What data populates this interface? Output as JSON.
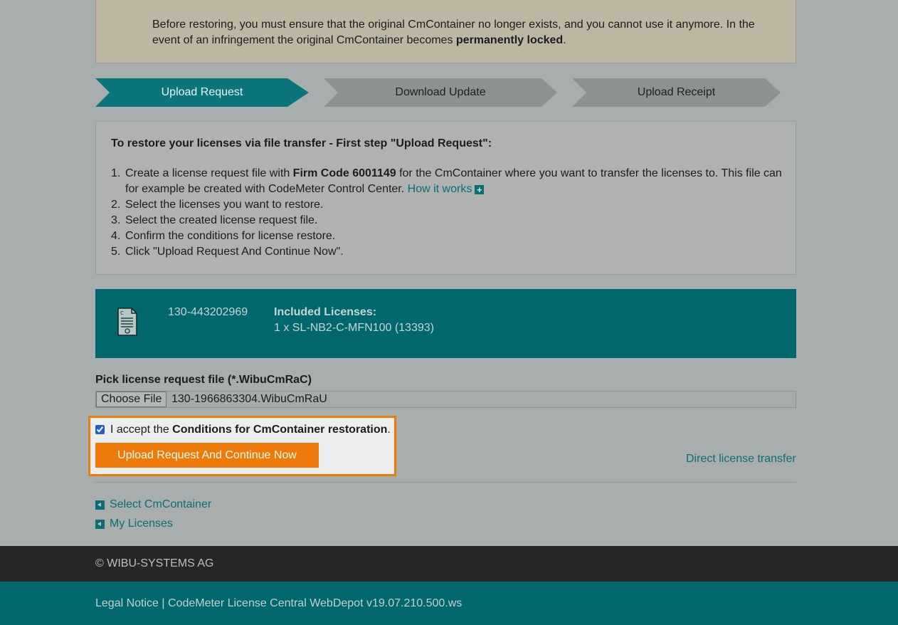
{
  "warning": {
    "text_before": "Before restoring, you must ensure that the original CmContainer no longer exists, and you cannot use it anymore. In the event of an infringement the original CmContainer becomes ",
    "text_bold": "permanently locked",
    "text_after": "."
  },
  "steps": [
    {
      "label": "Upload Request",
      "active": true
    },
    {
      "label": "Download Update",
      "active": false
    },
    {
      "label": "Upload Receipt",
      "active": false
    }
  ],
  "instructions": {
    "title": "To restore your licenses via file transfer - First step \"Upload Request\":",
    "items": [
      {
        "num": "1.",
        "text_before": "Create a license request file with ",
        "bold": "Firm Code 6001149",
        "text_after": " for the CmContainer where you want to transfer the licenses to. This file can for example be created with CodeMeter Control Center. ",
        "link": "How it works"
      },
      {
        "num": "2.",
        "text": "Select the licenses you want to restore."
      },
      {
        "num": "3.",
        "text": "Select the created license request file."
      },
      {
        "num": "4.",
        "text": "Confirm the conditions for license restore."
      },
      {
        "num": "5.",
        "text": "Click \"Upload Request And Continue Now\"."
      }
    ]
  },
  "container": {
    "serial": "130-443202969",
    "licenses_label": "Included Licenses:",
    "licenses_value": "1 x SL-NB2-C-MFN100 (13393)"
  },
  "file_picker": {
    "label": "Pick license request file (*.WibuCmRaC)",
    "button_label": "Choose File",
    "file_name": "130-1966863304.WibuCmRaU"
  },
  "accept": {
    "checked": true,
    "text_before": "I accept the ",
    "bold": "Conditions for CmContainer restoration",
    "text_after": ".",
    "button_label": "Upload Request And Continue Now"
  },
  "direct_link": "Direct license transfer",
  "back_links": [
    "Select CmContainer",
    "My Licenses"
  ],
  "footer": {
    "copyright": "© WIBU-SYSTEMS AG",
    "legal": "Legal Notice | CodeMeter License Central WebDepot v19.07.210.500.ws"
  },
  "colors": {
    "teal": "#00686d",
    "orange": "#ee7a0c",
    "link": "#0a6e73"
  }
}
